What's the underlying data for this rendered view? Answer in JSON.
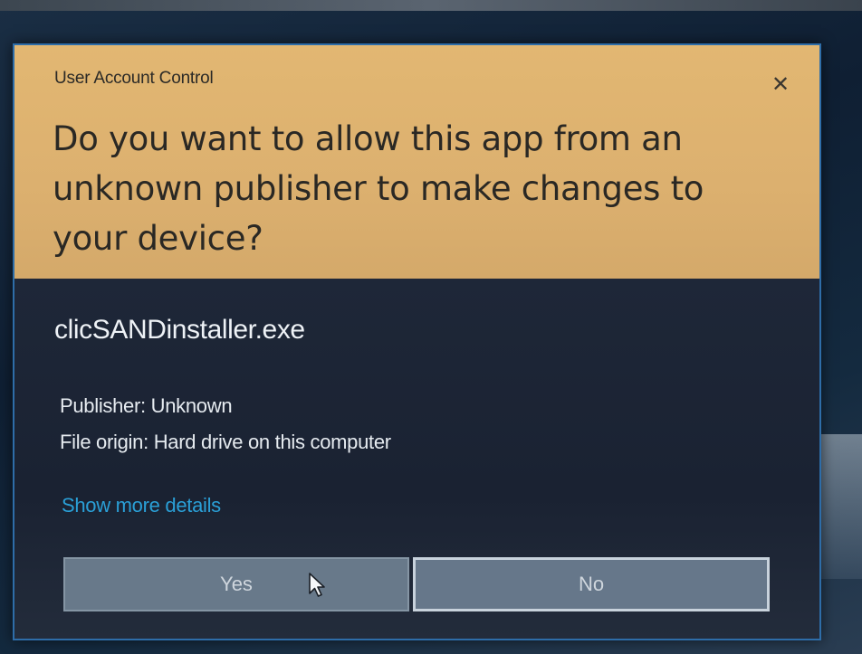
{
  "dialog": {
    "caption": "User Account Control",
    "close_glyph": "✕",
    "question": "Do you want to allow this app from an unknown publisher to make changes to your device?",
    "app_name": "clicSANDinstaller.exe",
    "publisher": "Publisher: Unknown",
    "file_origin": "File origin: Hard drive on this computer",
    "details_link": "Show more details",
    "yes_label": "Yes",
    "no_label": "No"
  },
  "colors": {
    "header_bg": "#dcb06f",
    "body_bg": "#1b2433",
    "link": "#2a9fd6",
    "button_bg": "#68798a"
  },
  "icons": [
    "close-icon",
    "mouse-cursor-icon"
  ]
}
